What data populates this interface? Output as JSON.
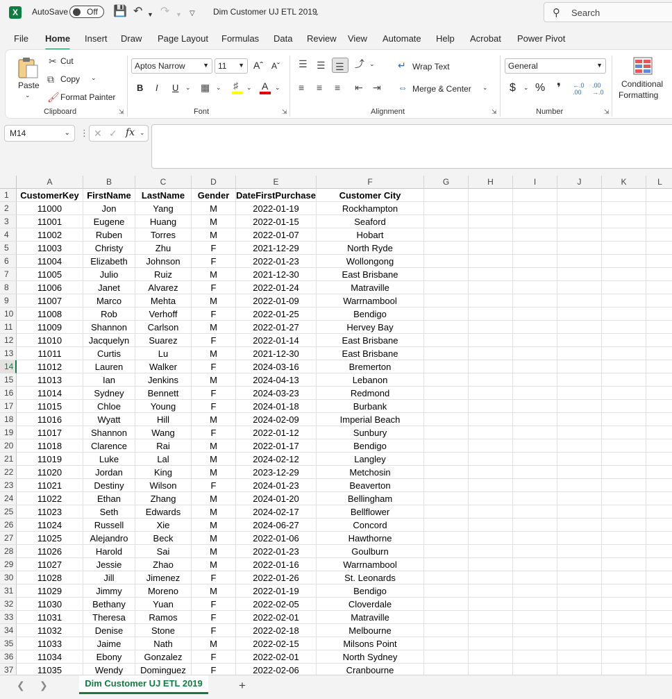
{
  "titlebar": {
    "autosave_label": "AutoSave",
    "autosave_state": "Off",
    "doc_title": "Dim Customer UJ ETL 2019",
    "search_placeholder": "Search"
  },
  "tabs": [
    "File",
    "Home",
    "Insert",
    "Draw",
    "Page Layout",
    "Formulas",
    "Data",
    "Review",
    "View",
    "Automate",
    "Help",
    "Acrobat",
    "Power Pivot"
  ],
  "active_tab": "Home",
  "ribbon": {
    "clipboard": {
      "paste": "Paste",
      "cut": "Cut",
      "copy": "Copy",
      "format_painter": "Format Painter",
      "label": "Clipboard"
    },
    "font": {
      "font_name": "Aptos Narrow",
      "font_size": "11",
      "bold": "B",
      "italic": "I",
      "underline": "U",
      "label": "Font"
    },
    "alignment": {
      "wrap_text": "Wrap Text",
      "merge_center": "Merge & Center",
      "label": "Alignment"
    },
    "number": {
      "format": "General",
      "label": "Number"
    },
    "styles": {
      "conditional": "Conditional",
      "formatting": "Formatting"
    }
  },
  "formula_bar": {
    "name_box": "M14",
    "fx": "fx",
    "formula": ""
  },
  "grid": {
    "columns": [
      "A",
      "B",
      "C",
      "D",
      "E",
      "F",
      "G",
      "H",
      "I",
      "J",
      "K",
      "L"
    ],
    "header": [
      "CustomerKey",
      "FirstName",
      "LastName",
      "Gender",
      "DateFirstPurchase",
      "Customer City"
    ],
    "active_row": 14,
    "rows": [
      [
        "11000",
        "Jon",
        "Yang",
        "M",
        "2022-01-19",
        "Rockhampton"
      ],
      [
        "11001",
        "Eugene",
        "Huang",
        "M",
        "2022-01-15",
        "Seaford"
      ],
      [
        "11002",
        "Ruben",
        "Torres",
        "M",
        "2022-01-07",
        "Hobart"
      ],
      [
        "11003",
        "Christy",
        "Zhu",
        "F",
        "2021-12-29",
        "North Ryde"
      ],
      [
        "11004",
        "Elizabeth",
        "Johnson",
        "F",
        "2022-01-23",
        "Wollongong"
      ],
      [
        "11005",
        "Julio",
        "Ruiz",
        "M",
        "2021-12-30",
        "East Brisbane"
      ],
      [
        "11006",
        "Janet",
        "Alvarez",
        "F",
        "2022-01-24",
        "Matraville"
      ],
      [
        "11007",
        "Marco",
        "Mehta",
        "M",
        "2022-01-09",
        "Warrnambool"
      ],
      [
        "11008",
        "Rob",
        "Verhoff",
        "F",
        "2022-01-25",
        "Bendigo"
      ],
      [
        "11009",
        "Shannon",
        "Carlson",
        "M",
        "2022-01-27",
        "Hervey Bay"
      ],
      [
        "11010",
        "Jacquelyn",
        "Suarez",
        "F",
        "2022-01-14",
        "East Brisbane"
      ],
      [
        "11011",
        "Curtis",
        "Lu",
        "M",
        "2021-12-30",
        "East Brisbane"
      ],
      [
        "11012",
        "Lauren",
        "Walker",
        "F",
        "2024-03-16",
        "Bremerton"
      ],
      [
        "11013",
        "Ian",
        "Jenkins",
        "M",
        "2024-04-13",
        "Lebanon"
      ],
      [
        "11014",
        "Sydney",
        "Bennett",
        "F",
        "2024-03-23",
        "Redmond"
      ],
      [
        "11015",
        "Chloe",
        "Young",
        "F",
        "2024-01-18",
        "Burbank"
      ],
      [
        "11016",
        "Wyatt",
        "Hill",
        "M",
        "2024-02-09",
        "Imperial Beach"
      ],
      [
        "11017",
        "Shannon",
        "Wang",
        "F",
        "2022-01-12",
        "Sunbury"
      ],
      [
        "11018",
        "Clarence",
        "Rai",
        "M",
        "2022-01-17",
        "Bendigo"
      ],
      [
        "11019",
        "Luke",
        "Lal",
        "M",
        "2024-02-12",
        "Langley"
      ],
      [
        "11020",
        "Jordan",
        "King",
        "M",
        "2023-12-29",
        "Metchosin"
      ],
      [
        "11021",
        "Destiny",
        "Wilson",
        "F",
        "2024-01-23",
        "Beaverton"
      ],
      [
        "11022",
        "Ethan",
        "Zhang",
        "M",
        "2024-01-20",
        "Bellingham"
      ],
      [
        "11023",
        "Seth",
        "Edwards",
        "M",
        "2024-02-17",
        "Bellflower"
      ],
      [
        "11024",
        "Russell",
        "Xie",
        "M",
        "2024-06-27",
        "Concord"
      ],
      [
        "11025",
        "Alejandro",
        "Beck",
        "M",
        "2022-01-06",
        "Hawthorne"
      ],
      [
        "11026",
        "Harold",
        "Sai",
        "M",
        "2022-01-23",
        "Goulburn"
      ],
      [
        "11027",
        "Jessie",
        "Zhao",
        "M",
        "2022-01-16",
        "Warrnambool"
      ],
      [
        "11028",
        "Jill",
        "Jimenez",
        "F",
        "2022-01-26",
        "St. Leonards"
      ],
      [
        "11029",
        "Jimmy",
        "Moreno",
        "M",
        "2022-01-19",
        "Bendigo"
      ],
      [
        "11030",
        "Bethany",
        "Yuan",
        "F",
        "2022-02-05",
        "Cloverdale"
      ],
      [
        "11031",
        "Theresa",
        "Ramos",
        "F",
        "2022-02-01",
        "Matraville"
      ],
      [
        "11032",
        "Denise",
        "Stone",
        "F",
        "2022-02-18",
        "Melbourne"
      ],
      [
        "11033",
        "Jaime",
        "Nath",
        "M",
        "2022-02-15",
        "Milsons Point"
      ],
      [
        "11034",
        "Ebony",
        "Gonzalez",
        "F",
        "2022-02-01",
        "North Sydney"
      ],
      [
        "11035",
        "Wendy",
        "Dominguez",
        "F",
        "2022-02-06",
        "Cranbourne"
      ]
    ]
  },
  "sheets": [
    "Dim Customer UJ ETL 2019"
  ],
  "colors": {
    "accent": "#107c41",
    "font_color_bar": "#e00000",
    "highlight_bar": "#ffff00"
  }
}
